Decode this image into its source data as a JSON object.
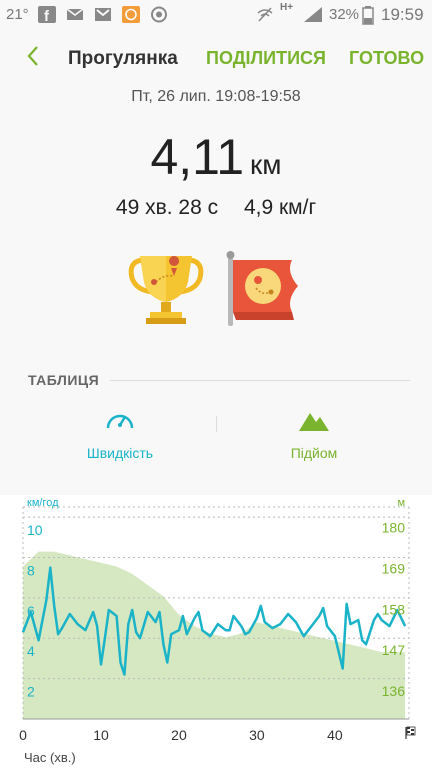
{
  "status_bar": {
    "temperature": "21°",
    "network": "H+",
    "battery": "32%",
    "time": "19:59",
    "icons": [
      "facebook-icon",
      "mail-icon",
      "gmail-icon",
      "app-icon",
      "lion-icon",
      "wifi-off-icon",
      "signal-icon",
      "battery-icon"
    ]
  },
  "header": {
    "title": "Прогулянка",
    "share": "ПОДІЛИТИСЯ",
    "done": "ГОТОВО"
  },
  "workout": {
    "date": "Пт, 26 лип. 19:08-19:58",
    "distance_value": "4,11",
    "distance_unit": "км",
    "duration": "49 хв. 28 с",
    "speed": "4,9 км/г"
  },
  "badges": [
    "trophy-icon",
    "flag-icon"
  ],
  "section_title": "ТАБЛИЦЯ",
  "tabs": [
    {
      "label": "Швидкість",
      "icon": "speedometer-icon",
      "color": "#1ab3c8",
      "selected": true
    },
    {
      "label": "Підйом",
      "icon": "mountain-icon",
      "color": "#7ab42e",
      "selected": false
    }
  ],
  "colors": {
    "accent": "#7ab42e",
    "speed": "#1ab3c8",
    "elevation_fill": "#d6e8c2"
  },
  "chart_data": {
    "type": "line",
    "xlabel": "Час (хв.)",
    "x_ticks": [
      "0",
      "10",
      "20",
      "30",
      "40"
    ],
    "xlim": [
      0,
      49.5
    ],
    "y_left": {
      "unit": "км/год",
      "ticks": [
        "10",
        "8",
        "6",
        "4",
        "2"
      ],
      "ylim": [
        0,
        10.5
      ]
    },
    "y_right": {
      "unit": "м",
      "ticks": [
        "180",
        "169",
        "158",
        "147",
        "136"
      ],
      "ylim": [
        125,
        182
      ]
    },
    "series": [
      {
        "axis": "left",
        "style": "line",
        "x": [
          0,
          1,
          2,
          3,
          3.5,
          4,
          4.5,
          5,
          6,
          7,
          8,
          9,
          9.5,
          10,
          10.5,
          11,
          12,
          12.5,
          13,
          13.5,
          14,
          14.5,
          15,
          16,
          17,
          17.5,
          18,
          18.5,
          19,
          20,
          20.5,
          21,
          22,
          22.5,
          23,
          24,
          25,
          26,
          26.5,
          27,
          28,
          28.5,
          29,
          30,
          30.5,
          31,
          32,
          33,
          34,
          35,
          36,
          37,
          38,
          38.5,
          39,
          40,
          40.5,
          41,
          41.5,
          42,
          43,
          43.5,
          44,
          45,
          45.5,
          46,
          47,
          48,
          49
        ],
        "y": [
          4.3,
          5.3,
          3.9,
          5.9,
          7.5,
          5.6,
          4.2,
          4.5,
          5.2,
          4.7,
          4.4,
          5.3,
          4.6,
          2.7,
          4.0,
          5.4,
          5.1,
          2.8,
          2.2,
          4.7,
          5.4,
          4.3,
          4.0,
          5.3,
          4.8,
          5.3,
          3.7,
          2.8,
          4.2,
          4.4,
          5.1,
          4.2,
          5.0,
          5.3,
          4.4,
          4.1,
          4.7,
          4.4,
          4.4,
          5.1,
          4.6,
          4.2,
          4.3,
          5.0,
          5.6,
          4.8,
          4.5,
          4.7,
          5.2,
          4.8,
          4.1,
          4.6,
          5.1,
          5.5,
          4.6,
          4.1,
          3.3,
          2.5,
          5.7,
          4.7,
          4.9,
          3.9,
          3.7,
          4.9,
          5.2,
          4.9,
          4.6,
          5.4,
          4.6
        ]
      },
      {
        "axis": "right",
        "style": "area",
        "x": [
          0,
          2,
          4,
          6,
          8,
          10,
          12,
          14,
          16,
          18,
          20,
          22,
          24,
          26,
          28,
          30,
          32,
          34,
          36,
          38,
          40,
          42,
          44,
          46,
          48,
          49
        ],
        "y": [
          166,
          170,
          170,
          169,
          168,
          167,
          166,
          164,
          161,
          158,
          153,
          150,
          148,
          147,
          148,
          151,
          150,
          149,
          148,
          147,
          146,
          145,
          144,
          143,
          143,
          143
        ]
      }
    ]
  }
}
